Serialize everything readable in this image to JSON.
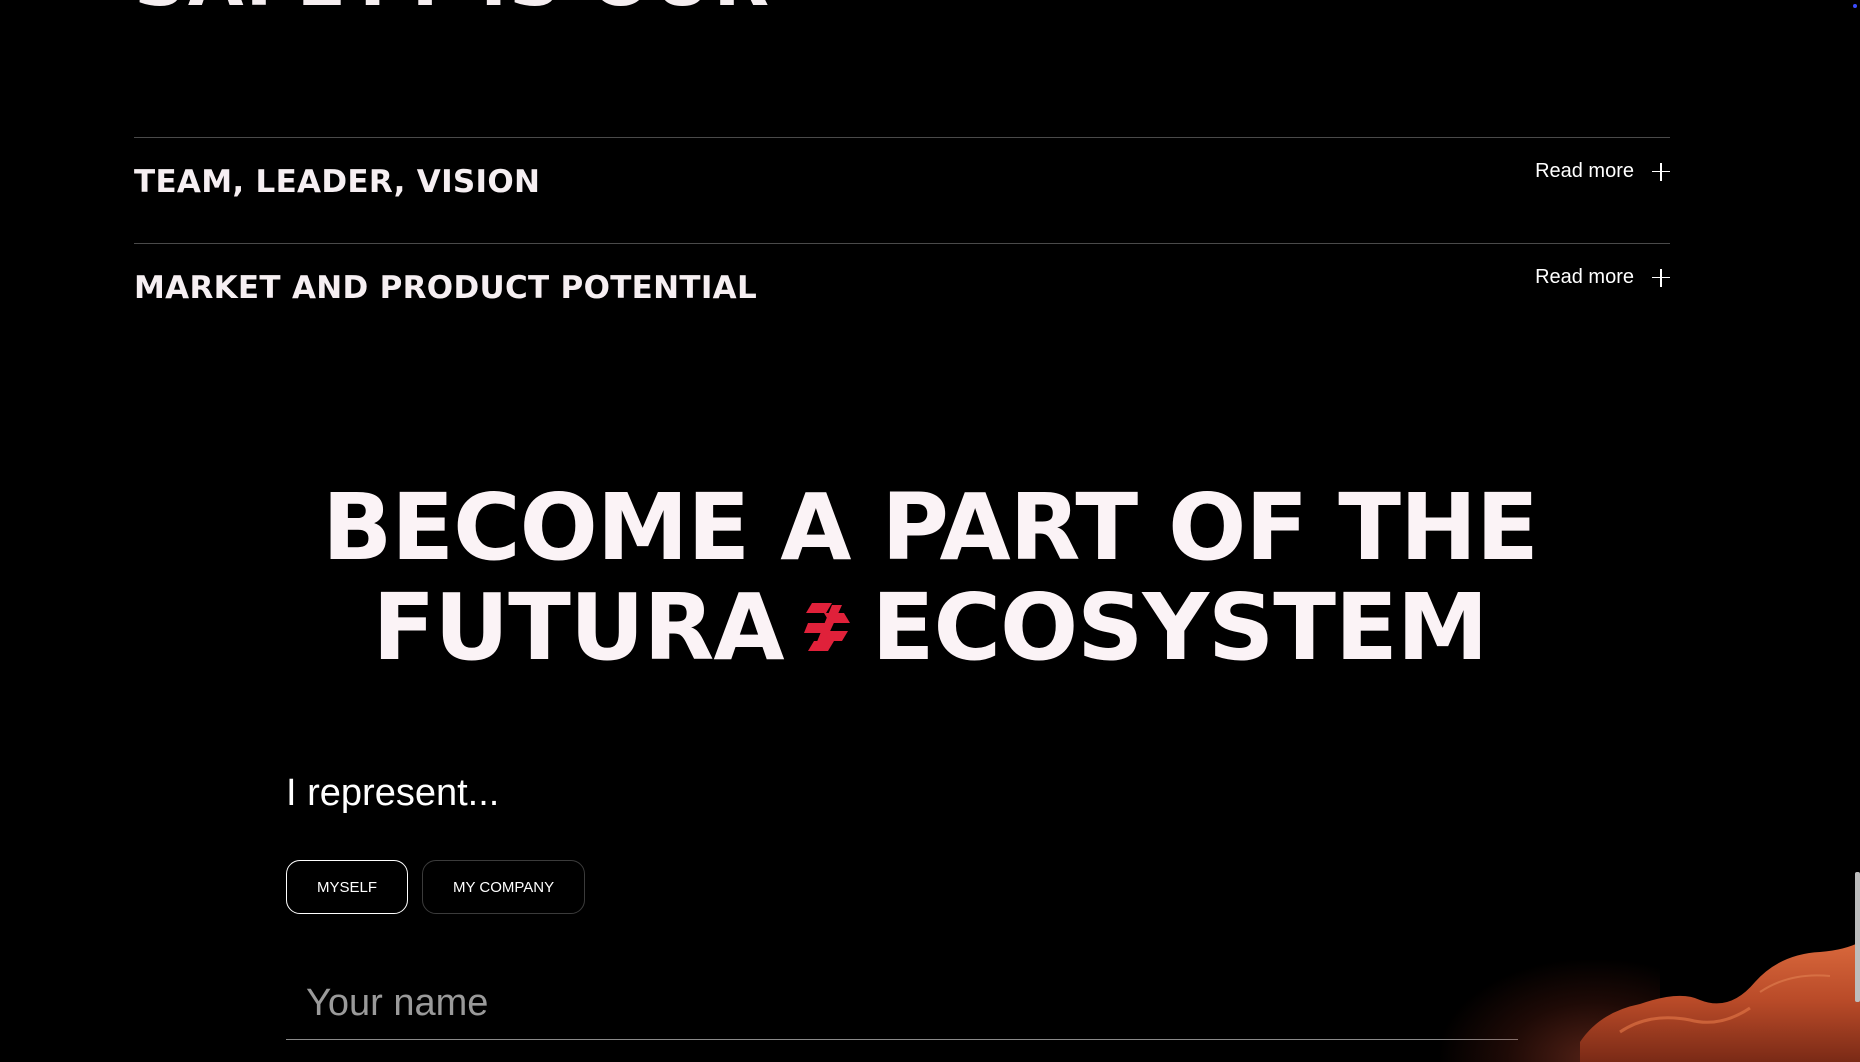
{
  "top_heading_cut": "SAFETY IS OUR",
  "accordion": [
    {
      "title": "TEAM, LEADER, VISION",
      "action_label": "Read more"
    },
    {
      "title": "MARKET AND PRODUCT POTENTIAL",
      "action_label": "Read more"
    }
  ],
  "cta": {
    "line1": "BECOME A PART OF THE",
    "line2_left": "FUTURA",
    "line2_right": "ECOSYSTEM",
    "logo_icon": "futura-logo-icon",
    "logo_color": "#e0213a"
  },
  "form": {
    "represent_label": "I represent...",
    "options": [
      {
        "label": "MYSELF",
        "selected": true
      },
      {
        "label": "MY COMPANY",
        "selected": false
      }
    ],
    "name_placeholder": "Your name"
  },
  "colors": {
    "background": "#000000",
    "text": "#ffffff",
    "accent": "#e0213a",
    "mars": "#c8552f"
  }
}
